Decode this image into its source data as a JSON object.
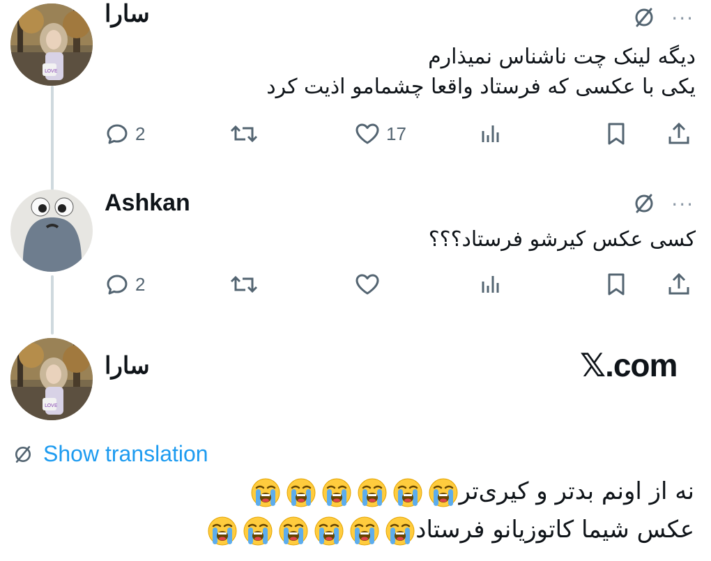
{
  "tweets": [
    {
      "author": "سارا",
      "lines": [
        "دیگه لینک چت ناشناس نمیذارم",
        "یکی با عکسی که فرستاد واقعا چشمامو اذیت کرد"
      ],
      "replies": "2",
      "likes": "17"
    },
    {
      "author": "Ashkan",
      "lines": [
        "کسی عکس کیرشو فرستاد؟؟؟"
      ],
      "replies": "2",
      "likes": ""
    },
    {
      "author": "سارا"
    }
  ],
  "watermark": {
    "mark": "𝕏",
    "domain": ".com"
  },
  "show_translation": "Show translation",
  "final_tweet": {
    "line1": "نه از اونم بدتر و کیری‌تر",
    "line2": "عکس شیما کاتوزیانو فرستاد",
    "emoji": "loudly-crying-face",
    "line1_emoji_count": 6,
    "line2_emoji_count": 6
  },
  "colors": {
    "accent": "#1d9bf0",
    "icon": "#536471",
    "thread": "#cfd9de"
  },
  "icons": [
    "reply-icon",
    "retweet-icon",
    "like-icon",
    "views-icon",
    "bookmark-icon",
    "share-icon",
    "grok-icon",
    "more-icon",
    "translate-icon"
  ]
}
